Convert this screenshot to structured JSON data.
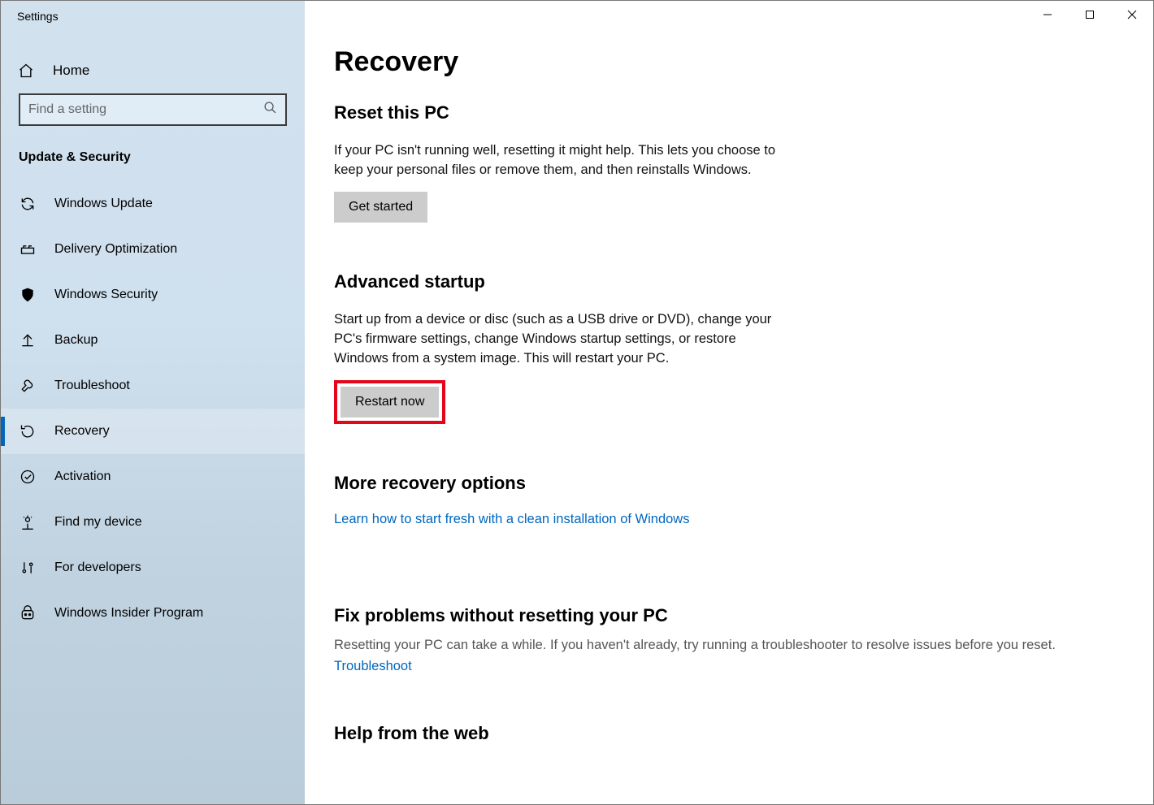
{
  "window": {
    "title": "Settings"
  },
  "sidebar": {
    "home": "Home",
    "search_placeholder": "Find a setting",
    "category": "Update & Security",
    "items": [
      {
        "label": "Windows Update"
      },
      {
        "label": "Delivery Optimization"
      },
      {
        "label": "Windows Security"
      },
      {
        "label": "Backup"
      },
      {
        "label": "Troubleshoot"
      },
      {
        "label": "Recovery"
      },
      {
        "label": "Activation"
      },
      {
        "label": "Find my device"
      },
      {
        "label": "For developers"
      },
      {
        "label": "Windows Insider Program"
      }
    ]
  },
  "main": {
    "title": "Recovery",
    "reset": {
      "heading": "Reset this PC",
      "desc": "If your PC isn't running well, resetting it might help. This lets you choose to keep your personal files or remove them, and then reinstalls Windows.",
      "button": "Get started"
    },
    "advanced": {
      "heading": "Advanced startup",
      "desc": "Start up from a device or disc (such as a USB drive or DVD), change your PC's firmware settings, change Windows startup settings, or restore Windows from a system image. This will restart your PC.",
      "button": "Restart now"
    },
    "more": {
      "heading": "More recovery options",
      "link": "Learn how to start fresh with a clean installation of Windows"
    },
    "fix": {
      "heading": "Fix problems without resetting your PC",
      "desc": "Resetting your PC can take a while. If you haven't already, try running a troubleshooter to resolve issues before you reset.",
      "link": "Troubleshoot"
    },
    "help": {
      "heading": "Help from the web"
    }
  }
}
